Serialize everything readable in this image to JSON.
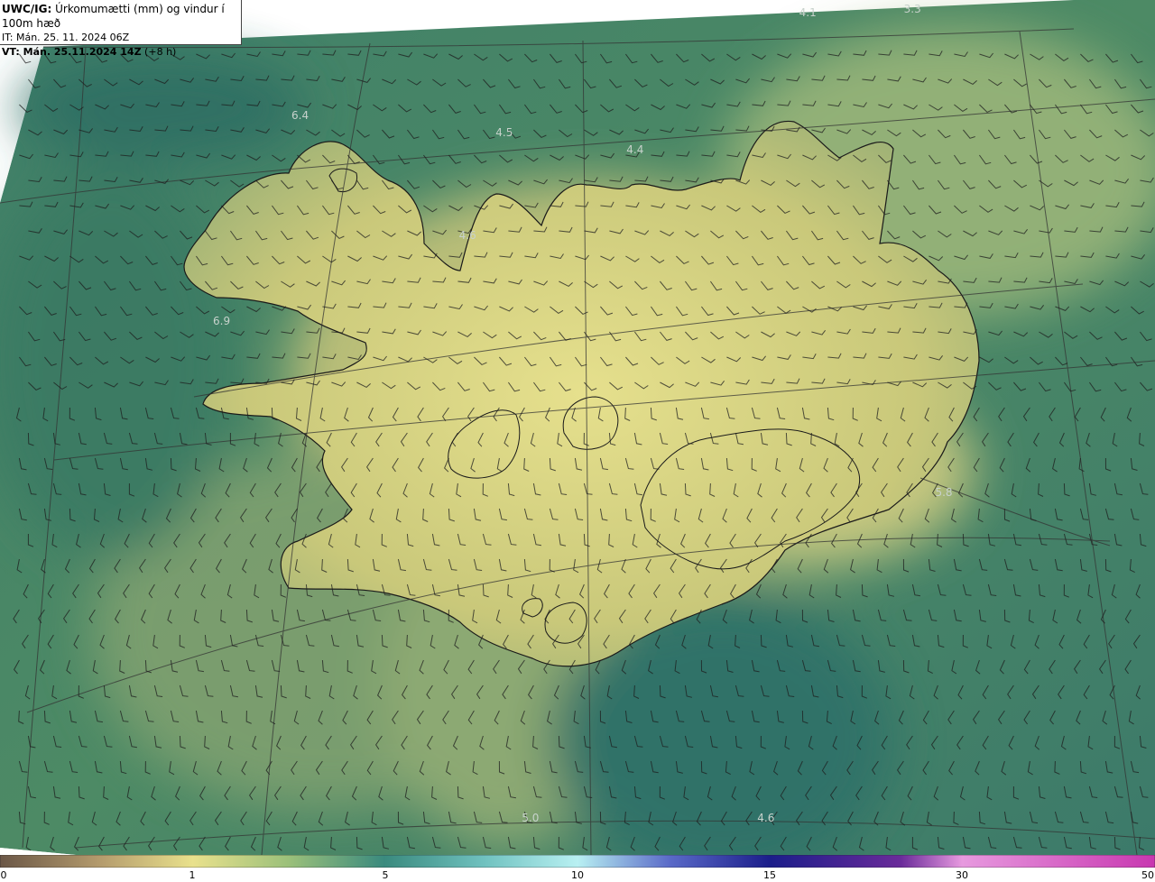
{
  "header": {
    "product": "UWC/IG:",
    "description": " Úrkomumætti (mm) og vindur í 100m hæð",
    "init_time": "IT: Mán. 25. 11. 2024 06Z",
    "valid_prefix": "VT: Mán. 25.11.2024 14Z",
    "valid_suffix": " (+8 h)"
  },
  "field_labels": [
    {
      "text": "3.3",
      "lon": -12.5,
      "lat": 67.8
    },
    {
      "text": "4.1",
      "lon": -14.5,
      "lat": 67.3
    },
    {
      "text": "6.4",
      "lon": -24.2,
      "lat": 66.7
    },
    {
      "text": "4.5",
      "lon": -20.3,
      "lat": 66.6
    },
    {
      "text": "4.4",
      "lon": -17.8,
      "lat": 66.5
    },
    {
      "text": "4.6",
      "lon": -21.0,
      "lat": 66.0
    },
    {
      "text": "6.9",
      "lon": -25.7,
      "lat": 65.5
    },
    {
      "text": "5.8",
      "lon": -11.9,
      "lat": 64.5
    },
    {
      "text": "5.0",
      "lon": -19.8,
      "lat": 62.6
    },
    {
      "text": "4.6",
      "lon": -15.3,
      "lat": 62.6
    }
  ],
  "colorbar": {
    "title": "Úrkomumætti (mm)",
    "ticks": [
      "0",
      "1",
      "5",
      "10",
      "15",
      "30",
      "50"
    ],
    "colors": [
      "#6b5747",
      "#b39a6c",
      "#e9e18c",
      "#7dab7a",
      "#3a8a7e",
      "#b8f0f2",
      "#1b1d8a",
      "#6a2b9a",
      "#e79adf",
      "#c837b0"
    ]
  },
  "map": {
    "ocean_color": "#3f7a63",
    "land_color": "#c9c87a",
    "coast_color": "#1a1a1a",
    "grid_color": "#3a3a3a",
    "barb_color": "#1d1d1d"
  }
}
